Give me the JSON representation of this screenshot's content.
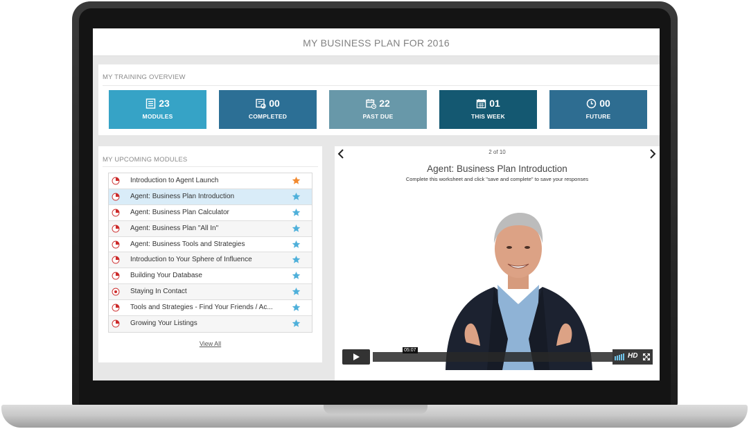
{
  "page": {
    "title": "MY BUSINESS PLAN FOR 2016"
  },
  "overview": {
    "label": "MY TRAINING OVERVIEW",
    "stats": [
      {
        "id": "modules",
        "count": "23",
        "label": "MODULES",
        "color": "#36a3c6",
        "icon": "list-icon"
      },
      {
        "id": "completed",
        "count": "00",
        "label": "COMPLETED",
        "color": "#2c6f95",
        "icon": "certificate-icon"
      },
      {
        "id": "past-due",
        "count": "22",
        "label": "PAST DUE",
        "color": "#6898a9",
        "icon": "calendar-clock-icon"
      },
      {
        "id": "this-week",
        "count": "01",
        "label": "THIS WEEK",
        "color": "#145871",
        "icon": "calendar-icon"
      },
      {
        "id": "future",
        "count": "00",
        "label": "FUTURE",
        "color": "#2e6d91",
        "icon": "clock-icon"
      }
    ]
  },
  "modules": {
    "label": "MY UPCOMING MODULES",
    "items": [
      {
        "name": "Introduction to Agent Launch",
        "progress": 0.25,
        "star_color": "#f28a30",
        "active": false
      },
      {
        "name": "Agent: Business Plan Introduction",
        "progress": 0.25,
        "star_color": "#4fb0da",
        "active": true
      },
      {
        "name": "Agent: Business Plan Calculator",
        "progress": 0.25,
        "star_color": "#4fb0da",
        "active": false
      },
      {
        "name": "Agent: Business Plan \"All In\"",
        "progress": 0.25,
        "star_color": "#4fb0da",
        "active": false
      },
      {
        "name": "Agent: Business Tools and Strategies",
        "progress": 0.25,
        "star_color": "#4fb0da",
        "active": false
      },
      {
        "name": "Introduction to Your Sphere of Influence",
        "progress": 0.25,
        "star_color": "#4fb0da",
        "active": false
      },
      {
        "name": "Building Your Database",
        "progress": 0.25,
        "star_color": "#4fb0da",
        "active": false
      },
      {
        "name": "Staying In Contact",
        "progress": 0,
        "star_color": "#4fb0da",
        "active": false
      },
      {
        "name": "Tools and Strategies - Find Your Friends / Ac...",
        "progress": 0.25,
        "star_color": "#4fb0da",
        "active": false
      },
      {
        "name": "Growing Your Listings",
        "progress": 0.25,
        "star_color": "#4fb0da",
        "active": false
      }
    ],
    "view_all": "View All"
  },
  "player": {
    "pager": "2 of 10",
    "title": "Agent: Business Plan Introduction",
    "subtitle": "Complete this worksheet and click \"save and complete\" to save your responses",
    "time": "05:07",
    "hd_label": "HD"
  },
  "colors": {
    "pie_red": "#cc2b2b",
    "row_active": "#d9ecf8",
    "star_orange": "#f28a30",
    "star_blue": "#4fb0da"
  }
}
